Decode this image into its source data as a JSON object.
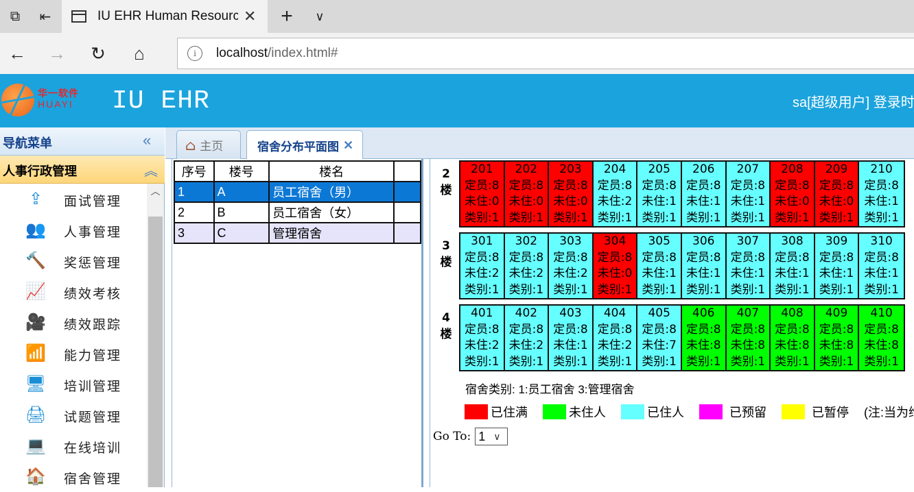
{
  "browser": {
    "tab_title": "IU EHR Human Resource",
    "url_host": "localhost",
    "url_path": "/index.html#"
  },
  "header": {
    "logo_cn": "华一软件",
    "logo_en": "HUAYI",
    "app_title": "IU EHR",
    "user_text": "sa[超级用户] 登录时"
  },
  "sidebar": {
    "title": "导航菜单",
    "group": "人事行政管理",
    "items": [
      {
        "label": "面试管理",
        "icon": "upload-icon"
      },
      {
        "label": "人事管理",
        "icon": "users-icon"
      },
      {
        "label": "奖惩管理",
        "icon": "hammer-icon"
      },
      {
        "label": "绩效考核",
        "icon": "chart-icon"
      },
      {
        "label": "绩效跟踪",
        "icon": "camera-icon"
      },
      {
        "label": "能力管理",
        "icon": "rss-icon"
      },
      {
        "label": "培训管理",
        "icon": "monitor-icon"
      },
      {
        "label": "试题管理",
        "icon": "printer-icon"
      },
      {
        "label": "在线培训",
        "icon": "desktop-icon"
      },
      {
        "label": "宿舍管理",
        "icon": "home-icon"
      }
    ]
  },
  "tabs": {
    "home": "主页",
    "active": "宿舍分布平面图"
  },
  "buildings": {
    "columns": [
      "序号",
      "楼号",
      "楼名",
      ""
    ],
    "rows": [
      {
        "no": "1",
        "code": "A",
        "name": "员工宿舍（男）"
      },
      {
        "no": "2",
        "code": "B",
        "name": "员工宿舍（女）"
      },
      {
        "no": "3",
        "code": "C",
        "name": "管理宿舍"
      }
    ]
  },
  "colors": {
    "full": "#ff0000",
    "vacant": "#00ff00",
    "occupied": "#66ffff",
    "reserved": "#ff00ff",
    "paused": "#ffff00"
  },
  "floors": [
    {
      "label": "2\n楼",
      "rooms": [
        {
          "no": "201",
          "cap": "定员:8",
          "free": "未住:0",
          "type": "类别:1",
          "status": "full"
        },
        {
          "no": "202",
          "cap": "定员:8",
          "free": "未住:0",
          "type": "类别:1",
          "status": "full"
        },
        {
          "no": "203",
          "cap": "定员:8",
          "free": "未住:0",
          "type": "类别:1",
          "status": "full"
        },
        {
          "no": "204",
          "cap": "定员:8",
          "free": "未住:2",
          "type": "类别:1",
          "status": "occupied"
        },
        {
          "no": "205",
          "cap": "定员:8",
          "free": "未住:1",
          "type": "类别:1",
          "status": "occupied"
        },
        {
          "no": "206",
          "cap": "定员:8",
          "free": "未住:1",
          "type": "类别:1",
          "status": "occupied"
        },
        {
          "no": "207",
          "cap": "定员:8",
          "free": "未住:1",
          "type": "类别:1",
          "status": "occupied"
        },
        {
          "no": "208",
          "cap": "定员:8",
          "free": "未住:0",
          "type": "类别:1",
          "status": "full"
        },
        {
          "no": "209",
          "cap": "定员:8",
          "free": "未住:0",
          "type": "类别:1",
          "status": "full"
        },
        {
          "no": "210",
          "cap": "定员:8",
          "free": "未住:1",
          "type": "类别:1",
          "status": "occupied"
        }
      ]
    },
    {
      "label": "3\n楼",
      "rooms": [
        {
          "no": "301",
          "cap": "定员:8",
          "free": "未住:2",
          "type": "类别:1",
          "status": "occupied"
        },
        {
          "no": "302",
          "cap": "定员:8",
          "free": "未住:2",
          "type": "类别:1",
          "status": "occupied"
        },
        {
          "no": "303",
          "cap": "定员:8",
          "free": "未住:2",
          "type": "类别:1",
          "status": "occupied"
        },
        {
          "no": "304",
          "cap": "定员:8",
          "free": "未住:0",
          "type": "类别:1",
          "status": "full"
        },
        {
          "no": "305",
          "cap": "定员:8",
          "free": "未住:1",
          "type": "类别:1",
          "status": "occupied"
        },
        {
          "no": "306",
          "cap": "定员:8",
          "free": "未住:1",
          "type": "类别:1",
          "status": "occupied"
        },
        {
          "no": "307",
          "cap": "定员:8",
          "free": "未住:1",
          "type": "类别:1",
          "status": "occupied"
        },
        {
          "no": "308",
          "cap": "定员:8",
          "free": "未住:1",
          "type": "类别:1",
          "status": "occupied"
        },
        {
          "no": "309",
          "cap": "定员:8",
          "free": "未住:1",
          "type": "类别:1",
          "status": "occupied"
        },
        {
          "no": "310",
          "cap": "定员:8",
          "free": "未住:1",
          "type": "类别:1",
          "status": "occupied"
        }
      ]
    },
    {
      "label": "4\n楼",
      "rooms": [
        {
          "no": "401",
          "cap": "定员:8",
          "free": "未住:2",
          "type": "类别:1",
          "status": "occupied"
        },
        {
          "no": "402",
          "cap": "定员:8",
          "free": "未住:2",
          "type": "类别:1",
          "status": "occupied"
        },
        {
          "no": "403",
          "cap": "定员:8",
          "free": "未住:1",
          "type": "类别:1",
          "status": "occupied"
        },
        {
          "no": "404",
          "cap": "定员:8",
          "free": "未住:2",
          "type": "类别:1",
          "status": "occupied"
        },
        {
          "no": "405",
          "cap": "定员:8",
          "free": "未住:7",
          "type": "类别:1",
          "status": "occupied"
        },
        {
          "no": "406",
          "cap": "定员:8",
          "free": "未住:8",
          "type": "类别:1",
          "status": "vacant"
        },
        {
          "no": "407",
          "cap": "定员:8",
          "free": "未住:8",
          "type": "类别:1",
          "status": "vacant"
        },
        {
          "no": "408",
          "cap": "定员:8",
          "free": "未住:8",
          "type": "类别:1",
          "status": "vacant"
        },
        {
          "no": "409",
          "cap": "定员:8",
          "free": "未住:8",
          "type": "类别:1",
          "status": "vacant"
        },
        {
          "no": "410",
          "cap": "定员:8",
          "free": "未住:8",
          "type": "类别:1",
          "status": "vacant"
        }
      ]
    }
  ],
  "legend": {
    "types_text": "宿舍类别:  1:员工宿舍 3:管理宿舍",
    "items": [
      {
        "label": "已住满",
        "status": "full"
      },
      {
        "label": "未住人",
        "status": "vacant"
      },
      {
        "label": "已住人",
        "status": "occupied"
      },
      {
        "label": "已预留",
        "status": "reserved"
      },
      {
        "label": "已暂停",
        "status": "paused"
      }
    ],
    "note": "(注:当为维"
  },
  "goto": {
    "label": "Go To:",
    "value": "1"
  }
}
